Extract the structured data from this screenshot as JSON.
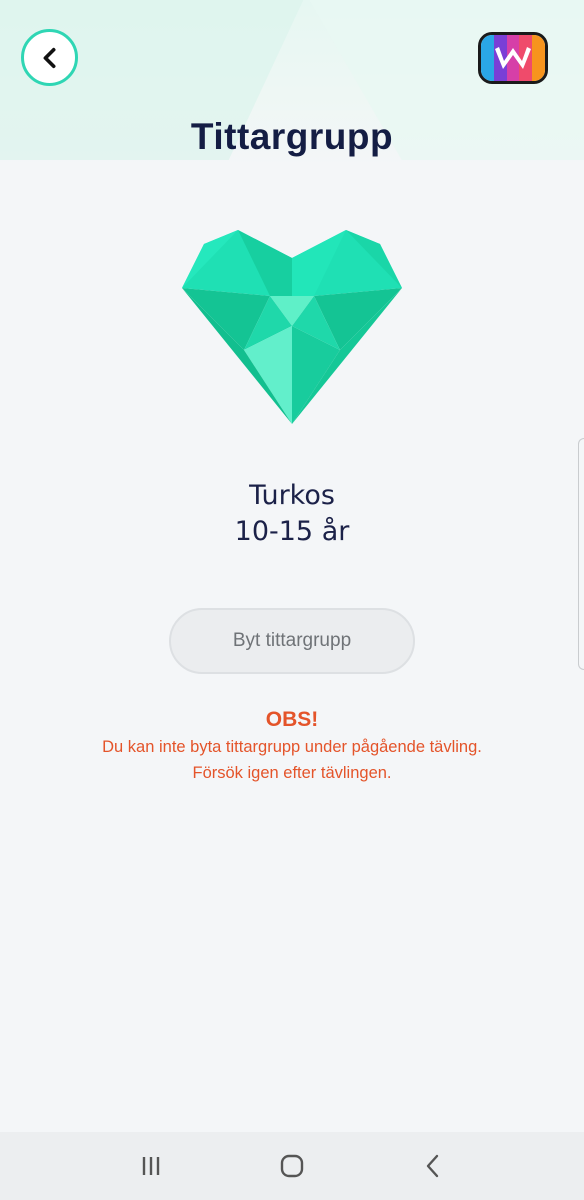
{
  "header": {
    "title": "Tittargrupp",
    "back_icon": "chevron-left-icon",
    "logo_icon": "app-logo-icon"
  },
  "group": {
    "icon": "heart-gem-icon",
    "name": "Turkos",
    "age": "10-15 år",
    "color": "#1fd6a6"
  },
  "change_button": {
    "label": "Byt tittargrupp"
  },
  "notice": {
    "title": "OBS!",
    "line1": "Du kan inte byta tittargrupp under pågående tävling.",
    "line2": "Försök igen efter tävlingen.",
    "color": "#e4542a"
  },
  "system_nav": {
    "recent_icon": "recent-apps-icon",
    "home_icon": "home-icon",
    "back_icon": "back-icon"
  },
  "colors": {
    "accent": "#2fd6b4",
    "title": "#141d44",
    "background": "#f4f6f8"
  }
}
